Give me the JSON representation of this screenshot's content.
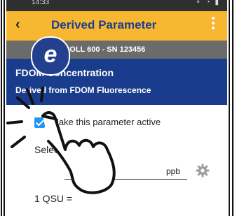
{
  "statusbar": {
    "time": "14:33",
    "icons": "⚬ ◔ ▮"
  },
  "appbar": {
    "back_icon": "‹",
    "title": "Derived Parameter"
  },
  "device": {
    "text": "qua TROLL 600 - SN 123456"
  },
  "hero": {
    "parameter": "FDOM Concentration",
    "derived_from": "Derived from FDOM Fluorescence"
  },
  "form": {
    "active_label": "Make this parameter active",
    "active_checked": true,
    "select_unit_label": "Select Unit",
    "unit_value": "ppb",
    "qsu_label": "1 QSU ="
  },
  "overlay": {
    "logo_letter": "e"
  },
  "colors": {
    "appbar": "#f7b731",
    "title": "#1d3f8f",
    "device_bar": "#6b6b6b",
    "hero": "#1a3c8d",
    "checkbox": "#2196f3"
  }
}
